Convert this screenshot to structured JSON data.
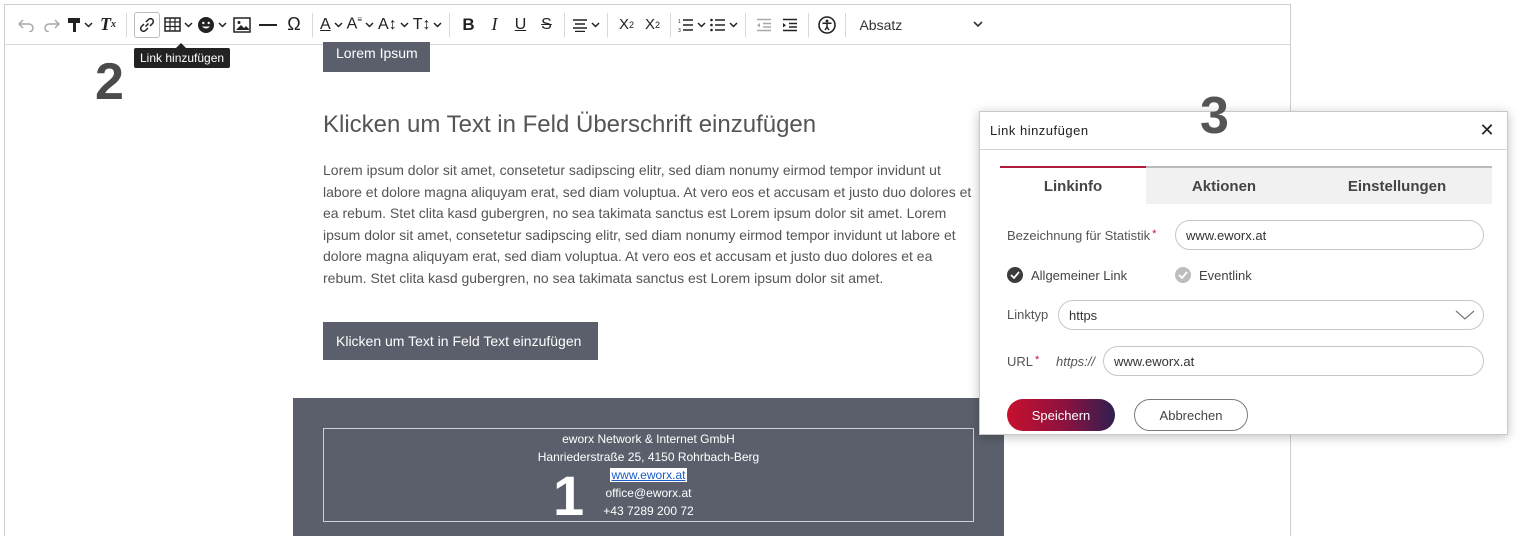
{
  "toolbar": {
    "tooltip": "Link hinzufügen",
    "paragraph_format": "Absatz",
    "icons": [
      "undo-icon",
      "redo-icon",
      "format-painter-icon",
      "remove-format-icon",
      "link-icon",
      "table-icon",
      "emoji-icon",
      "image-icon",
      "horizontal-line-icon",
      "special-char-icon",
      "font-color-icon",
      "font-size-icon",
      "line-height-icon",
      "text-transform-icon",
      "bold-icon",
      "italic-icon",
      "underline-icon",
      "strikethrough-icon",
      "align-icon",
      "subscript-icon",
      "superscript-icon",
      "numbered-list-icon",
      "bulleted-list-icon",
      "outdent-icon",
      "indent-icon",
      "accessibility-icon"
    ]
  },
  "steps": {
    "one": "1",
    "two": "2",
    "three": "3"
  },
  "content": {
    "top_button": "Lorem Ipsum",
    "heading": "Klicken um Text in Feld Überschrift einzufügen",
    "body": "Lorem ipsum dolor sit amet, consetetur sadipscing elitr, sed diam nonumy eirmod tempor invidunt ut labore et dolore magna aliquyam erat, sed diam voluptua. At vero eos et accusam et justo duo dolores et ea rebum. Stet clita kasd gubergren, no sea takimata sanctus est Lorem ipsum dolor sit amet. Lorem ipsum dolor sit amet, consetetur sadipscing elitr, sed diam nonumy eirmod tempor invidunt ut labore et dolore magna aliquyam erat, sed diam voluptua. At vero eos et accusam et justo duo dolores et ea rebum. Stet clita kasd gubergren, no sea takimata sanctus est Lorem ipsum dolor sit amet.",
    "bottom_button": "Klicken um Text in Feld Text einzufügen"
  },
  "footer": {
    "company": "eworx Network & Internet GmbH",
    "address": "Hanriederstraße 25, 4150 Rohrbach-Berg",
    "website": "www.eworx.at",
    "email": "office@eworx.at",
    "phone": "+43 7289 200 72"
  },
  "dialog": {
    "title": "Link hinzufügen",
    "close": "✕",
    "tabs": [
      "Linkinfo",
      "Aktionen",
      "Einstellungen"
    ],
    "stat_label": "Bezeichnung für Statistik",
    "stat_value": "www.eworx.at",
    "radio_general": "Allgemeiner Link",
    "radio_event": "Eventlink",
    "linktype_label": "Linktyp",
    "linktype_value": "https",
    "url_label": "URL",
    "url_prefix": "https://",
    "url_value": "www.eworx.at",
    "save": "Speichern",
    "cancel": "Abbrechen",
    "required_mark": "*"
  },
  "colors": {
    "accent": "#c8102e",
    "dark_block": "#5a5f6b",
    "link": "#1a5cc9"
  }
}
